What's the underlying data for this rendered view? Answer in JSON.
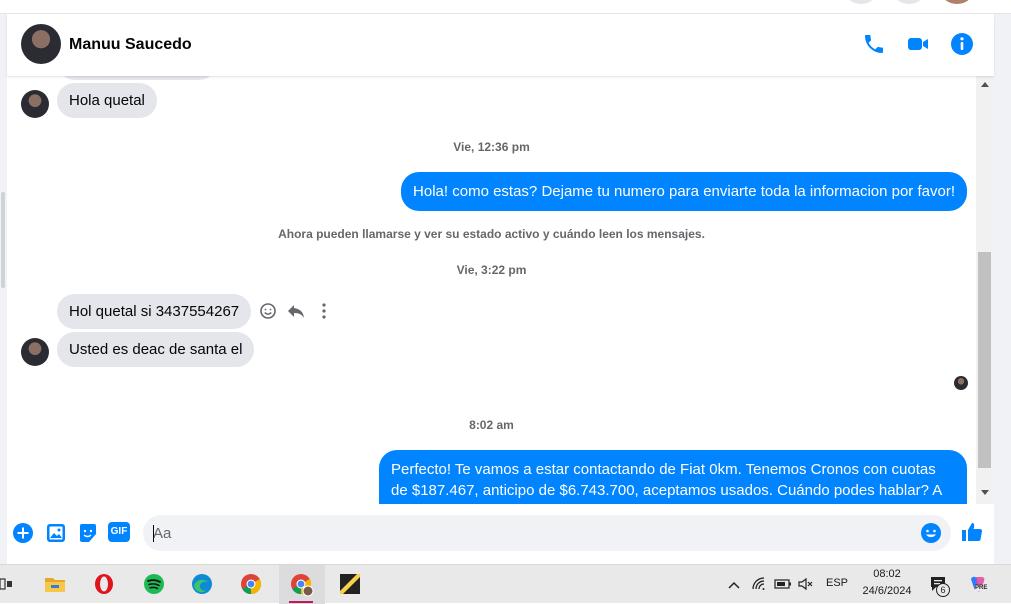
{
  "contact": {
    "name": "Manuu Saucedo"
  },
  "header_icons": [
    "phone-icon",
    "video-camera-icon",
    "info-icon"
  ],
  "messages": {
    "in1": "Hola quetal",
    "ts1": "Vie, 12:36 pm",
    "out1": "Hola! como estas? Dejame tu numero para enviarte toda la informacion por favor!",
    "system": "Ahora pueden llamarse y ver su estado activo y cuándo leen los mensajes.",
    "ts2": "Vie, 3:22 pm",
    "in2": "Hol quetal si 3437554267",
    "in3": "Usted es deac de santa el",
    "ts3": "8:02 am",
    "out2": "Perfecto! Te vamos a estar contactando de Fiat 0km. Tenemos Cronos con cuotas de $187.467, anticipo de $6.743.700, aceptamos usados. Cuándo podes hablar? A la mañana o a la tarde?"
  },
  "composer": {
    "placeholder": "Aa",
    "gif_label": "GIF",
    "icons": [
      "plus-icon",
      "image-icon",
      "sticker-icon",
      "gif-icon",
      "emoji-icon",
      "thumbs-up-icon"
    ]
  },
  "taskbar": {
    "apps": [
      "task-view-icon",
      "file-explorer-icon",
      "opera-icon",
      "spotify-icon",
      "edge-icon",
      "chrome-icon",
      "chrome-profile-icon",
      "sticky-notes-icon"
    ],
    "language": "ESP",
    "time": "08:02",
    "date": "24/6/2024",
    "notification_count": "6",
    "copilot_badge": "PRE"
  },
  "colors": {
    "accent": "#0084ff",
    "bubble_in": "#e4e6eb",
    "meta_text": "#65676b"
  }
}
